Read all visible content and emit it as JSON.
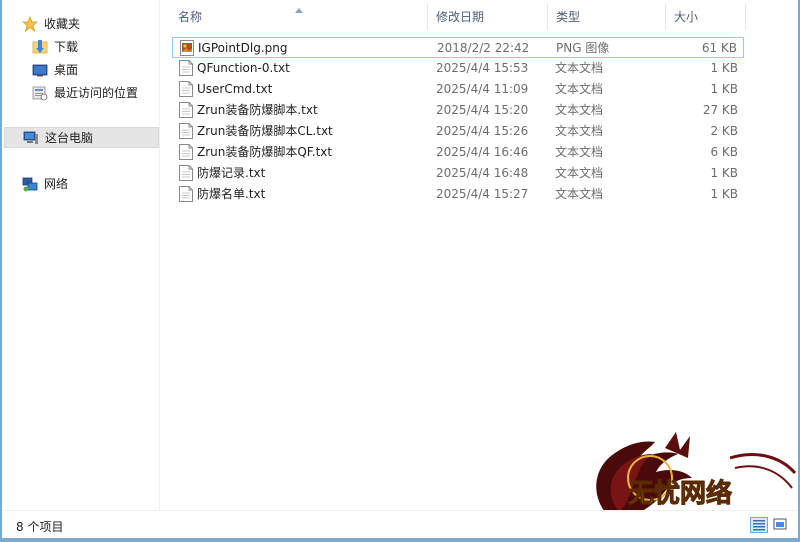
{
  "nav": {
    "favorites": "收藏夹",
    "downloads": "下载",
    "desktop": "桌面",
    "recent": "最近访问的位置",
    "this_pc": "这台电脑",
    "network": "网络"
  },
  "columns": {
    "name": "名称",
    "date": "修改日期",
    "type": "类型",
    "size": "大小"
  },
  "files": [
    {
      "name": "IGPointDlg.png",
      "date": "2018/2/2 22:42",
      "type": "PNG 图像",
      "size": "61 KB",
      "icon": "png-image-icon"
    },
    {
      "name": "QFunction-0.txt",
      "date": "2025/4/4 15:53",
      "type": "文本文档",
      "size": "1 KB",
      "icon": "text-file-icon"
    },
    {
      "name": "UserCmd.txt",
      "date": "2025/4/4 11:09",
      "type": "文本文档",
      "size": "1 KB",
      "icon": "text-file-icon"
    },
    {
      "name": "Zrun装备防爆脚本.txt",
      "date": "2025/4/4 15:20",
      "type": "文本文档",
      "size": "27 KB",
      "icon": "text-file-icon"
    },
    {
      "name": "Zrun装备防爆脚本CL.txt",
      "date": "2025/4/4 15:26",
      "type": "文本文档",
      "size": "2 KB",
      "icon": "text-file-icon"
    },
    {
      "name": "Zrun装备防爆脚本QF.txt",
      "date": "2025/4/4 16:46",
      "type": "文本文档",
      "size": "6 KB",
      "icon": "text-file-icon"
    },
    {
      "name": "防爆记录.txt",
      "date": "2025/4/4 16:48",
      "type": "文本文档",
      "size": "1 KB",
      "icon": "text-file-icon"
    },
    {
      "name": "防爆名单.txt",
      "date": "2025/4/4 15:27",
      "type": "文本文档",
      "size": "1 KB",
      "icon": "text-file-icon"
    }
  ],
  "status": {
    "item_count": "8 个项目"
  },
  "watermark": {
    "title": "无忧网络"
  },
  "colors": {
    "accent": "#7aaad4",
    "selection_border": "#99c9ef",
    "header_text": "#4c607a"
  }
}
